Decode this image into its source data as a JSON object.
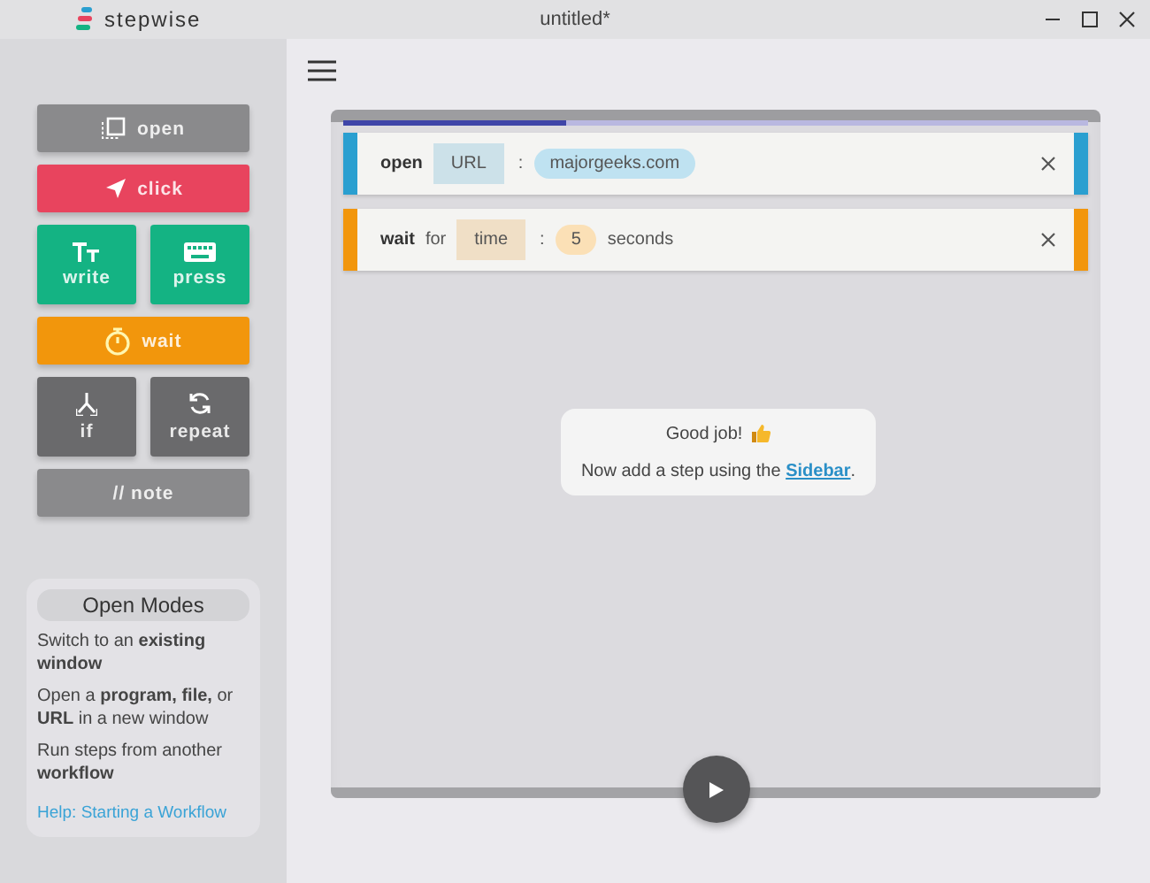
{
  "window": {
    "app_name": "stepwise",
    "title": "untitled*"
  },
  "palette": [
    {
      "kind": "open",
      "label": "open",
      "color": "#8a8a8c",
      "half": false
    },
    {
      "kind": "click",
      "label": "click",
      "color": "#e8445e",
      "half": false
    },
    {
      "kind": "write",
      "label": "write",
      "color": "#14b383",
      "half": true
    },
    {
      "kind": "press",
      "label": "press",
      "color": "#14b383",
      "half": true
    },
    {
      "kind": "wait",
      "label": "wait",
      "color": "#f2960c",
      "half": false
    },
    {
      "kind": "if",
      "label": "if",
      "color": "#6a6a6c",
      "half": true
    },
    {
      "kind": "repeat",
      "label": "repeat",
      "color": "#6a6a6c",
      "half": true
    },
    {
      "kind": "note",
      "label": "// note",
      "color": "#8a8a8c",
      "half": false
    }
  ],
  "help": {
    "title": "Open Modes",
    "items": [
      "Switch to an **existing window**",
      "Open a **program, file,** or **URL** in a new window",
      "Run steps from another **workflow**"
    ],
    "link": "Help: Starting a Workflow"
  },
  "workflow": {
    "progress": {
      "level": 0.3
    },
    "steps": [
      {
        "verb": "open",
        "color": "#2a9fd0",
        "tokens": [
          {
            "kind": "field",
            "text": "URL"
          },
          {
            "kind": "colon",
            "text": ":"
          },
          {
            "kind": "value",
            "text": "majorgeeks.com"
          }
        ]
      },
      {
        "verb": "wait",
        "color": "#f2960c",
        "tokens": [
          {
            "kind": "word",
            "text": "for"
          },
          {
            "kind": "field",
            "text": "time"
          },
          {
            "kind": "colon",
            "text": ":"
          },
          {
            "kind": "value",
            "text": "5"
          },
          {
            "kind": "word",
            "text": "seconds"
          }
        ]
      }
    ],
    "message": {
      "title": "Good job!",
      "text": "Now add a step using the",
      "link": "Sidebar",
      "after": "."
    }
  }
}
